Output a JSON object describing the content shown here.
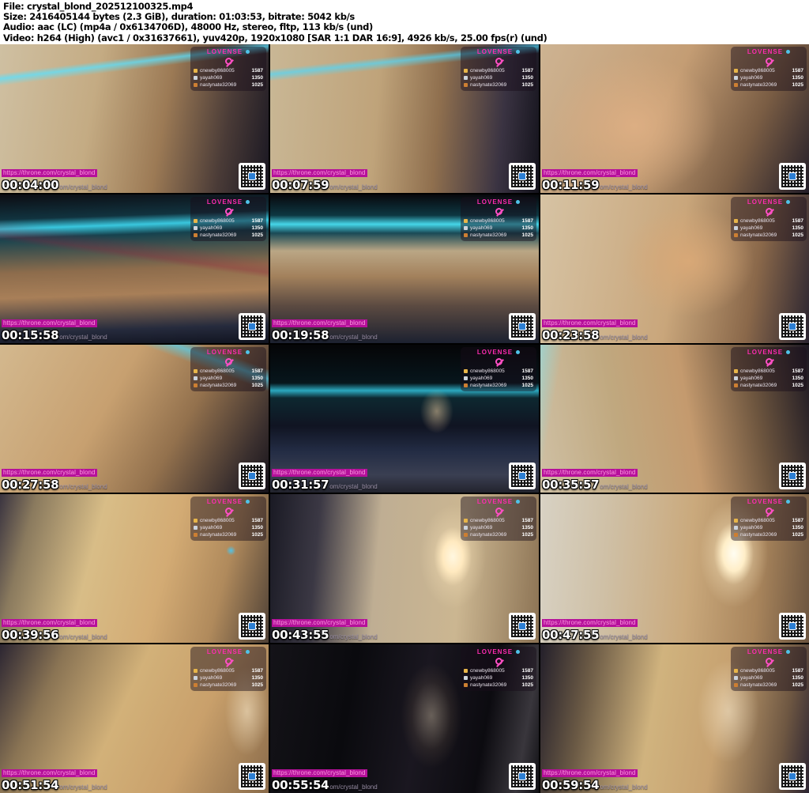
{
  "header": {
    "lines": [
      "File: crystal_blond_202512100325.mp4",
      "Size: 2416405144 bytes (2.3 GiB), duration: 01:03:53, bitrate: 5042 kb/s",
      "Audio: aac (LC) (mp4a / 0x6134706D), 48000 Hz, stereo, fltp, 113 kb/s (und)",
      "Video: h264 (High) (avc1 / 0x31637661), yuv420p, 1920x1080 [SAR 1:1 DAR 16:9], 4926 kb/s, 25.00 fps(r) (und)"
    ]
  },
  "watermark": {
    "url": "https://throne.com/crystal_blond",
    "partial": "om/crystal_blond"
  },
  "overlay": {
    "brand": "LOVENSE",
    "leaderboard": [
      {
        "rank": 1,
        "name": "cnewby868005",
        "score": "1587"
      },
      {
        "rank": 2,
        "name": "yayah069",
        "score": "1350"
      },
      {
        "rank": 3,
        "name": "nastynate32069",
        "score": "1025"
      }
    ]
  },
  "colors": {
    "header_bg": "#ffffff",
    "header_text": "#000000",
    "sheet_bg": "#000000",
    "watermark_bg": "#b5109a",
    "watermark_text": "#ff9be2",
    "watermark_partial_text": "#9a8fa6",
    "timestamp_text": "#ffffff",
    "brand_pink": "#ff2bb1",
    "led_cyan": "#45d5e8",
    "trophy_gold": "#e8b64a",
    "trophy_silver": "#ccd3dd",
    "trophy_bronze": "#cd7f32",
    "blue_heart": "#4fc3e8"
  },
  "grid": {
    "rows": 5,
    "cols": 3
  },
  "thumbs": [
    {
      "timestamp": "00:04:00",
      "scene": "bedroom, LED headboard",
      "bg": "linear-gradient(173deg, transparent 16%, rgba(90,225,255,.75) 19%, rgba(90,225,255,0) 23%), linear-gradient(100deg, #cfc0a2 0%, #c4ab83 35%, #9c7a55 60%, #4a3b37 82%, #191722 100%)"
    },
    {
      "timestamp": "00:07:59",
      "scene": "bedroom, LED headboard",
      "bg": "linear-gradient(174deg, transparent 14%, rgba(80,215,250,.7) 17%, transparent 21%), linear-gradient(95deg, #c9b795 0%, #bfa37a 40%, #8f6f4e 62%, #3a3342 85%, #14131c 100%)"
    },
    {
      "timestamp": "00:11:59",
      "scene": "bright close-up",
      "bg": "radial-gradient(140px 120px at 35% 55%, #dcae83, rgba(220,174,131,0) 75%), linear-gradient(115deg, #cdb392 0%, #c49d74 45%, #7a5d44 75%, #221d28 100%)"
    },
    {
      "timestamp": "00:15:58",
      "scene": "dim bedroom, cyan LED bar",
      "bg": "linear-gradient(8deg, transparent 55%, rgba(150,30,60,.3) 58%, transparent 66%), linear-gradient(178deg, #0c0c12 0%, #11333f 16%, #39c7de 22%, #16424e 28%, #8d6c4c 50%, #a87f58 66%, #262b3d 88%, #10131f 100%)"
    },
    {
      "timestamp": "00:19:58",
      "scene": "dim bedroom, cyan LED bar",
      "bg": "linear-gradient(180deg, #08080c 0%, #0d3742 14%, #45d5e8 20%, #1a4a56 26%, #baa685 38%, #a3815c 55%, #5b4a41 75%, #1c2130 100%)"
    },
    {
      "timestamp": "00:23:58",
      "scene": "bright close-up",
      "bg": "radial-gradient(120px 100px at 55% 45%, #d8a877, rgba(216,168,119,0) 70%), linear-gradient(100deg, #d6c3a4 0%, #c9a67b 50%, #8a684a 78%, #2a2430 100%)"
    },
    {
      "timestamp": "00:27:58",
      "scene": "warm close-up, LED streak",
      "bg": "linear-gradient(200deg, transparent 10%, rgba(80,215,250,.65) 14%, transparent 19%), linear-gradient(120deg, #d3b88e 0%, #c7a070 40%, #93714d 65%, #3a2f2e 88%, #15121a 100%)"
    },
    {
      "timestamp": "00:31:57",
      "scene": "dark empty bedroom, teal LED",
      "bg": "radial-gradient(30px 40px at 62% 45%, rgba(255,220,170,.5), transparent 70%), linear-gradient(180deg, #050507 0%, #07161c 26%, #2ba8be 31%, #0d2830 36%, #101422 55%, #232c44 72%, #3a3f52 88%, #23242e 100%)"
    },
    {
      "timestamp": "00:35:57",
      "scene": "warm close-up by headboard",
      "bg": "linear-gradient(100deg, rgba(120,230,250,.5) 0%, transparent 8%), linear-gradient(80deg, #cfc0a4 0%, #c0a87f 30%, #c49a6e 55%, #6e563f 78%, #1c1822 100%)"
    },
    {
      "timestamp": "00:39:56",
      "scene": "bright close-up, blue dot",
      "bg": "radial-gradient(8px 8px at 86% 38%, #4fc3e8, transparent 75%), linear-gradient(105deg, #3a3440 0%, #8a7a5e 12%, #d8bd87 35%, #d3ab74 60%, #b08a5c 80%, #4f4136 100%)"
    },
    {
      "timestamp": "00:43:55",
      "scene": "room with lighted oval mirror",
      "bg": "radial-gradient(70px 110px at 68% 42%, #fff7e0 0%, #ffe9bf 18%, rgba(255,233,191,.25) 34%, transparent 60%), linear-gradient(95deg, #1a1a24 0%, #3b3844 18%, #bfae93 40%, #cbb691 70%, #8c7354 100%)"
    },
    {
      "timestamp": "00:47:55",
      "scene": "bright room, lighted oval mirror",
      "bg": "radial-gradient(70px 110px at 72% 40%, #fffdf2 0%, #ffeec8 20%, rgba(255,238,200,.3) 36%, transparent 62%), linear-gradient(95deg, #d8d2c4 0%, #cfc0a6 25%, #caa97c 55%, #a9855c 80%, #6b543f 100%)"
    },
    {
      "timestamp": "00:51:54",
      "scene": "warm close-up, mirror glow",
      "bg": "radial-gradient(40px 80px at 92% 45%, rgba(255,240,210,.55), transparent 70%), linear-gradient(115deg, #2c2632 0%, #8a7454 20%, #d2b179 45%, #c9a06b 70%, #8a6b4a 100%)"
    },
    {
      "timestamp": "00:55:54",
      "scene": "dark room, faint lighted mirror",
      "bg": "radial-gradient(55px 95px at 60% 48%, rgba(255,235,200,.35) 0%, rgba(120,100,80,.18) 45%, transparent 70%), linear-gradient(100deg, #141318 0%, #0a0a0e 30%, #1a1720 55%, #0c0b10 78%, #39363c 92%, #101014 100%)"
    },
    {
      "timestamp": "00:59:54",
      "scene": "warm close-up, mirror behind",
      "bg": "radial-gradient(60px 100px at 70% 45%, rgba(255,244,220,.5), transparent 65%), linear-gradient(100deg, #231f2a 0%, #6b5a45 18%, #d0b37e 42%, #c7a271 65%, #6e5742 88%, #2c2431 100%)"
    }
  ]
}
